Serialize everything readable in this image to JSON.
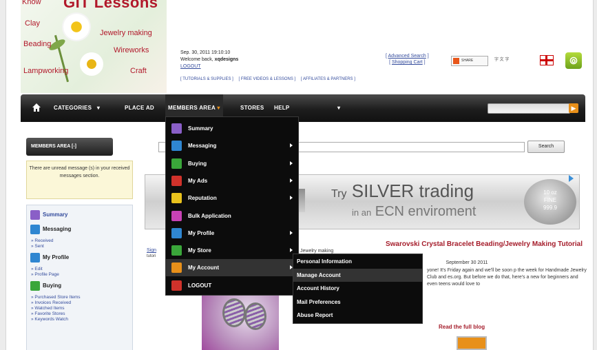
{
  "logo": {
    "title": "GIT Lessons",
    "know": "Know",
    "words": [
      "Clay",
      "Jewelry making",
      "Beading",
      "Wireworks",
      "Lampworking",
      "Craft"
    ]
  },
  "header": {
    "datetime": "Sep. 30, 2011 19:10:10",
    "welcome_prefix": "Welcome back, ",
    "username": "xqdesigns",
    "logout": "LOGOUT",
    "links": [
      "[ TUTORIALS & SUPPLIES ]",
      "[ FREE VIDEOS & LESSONS ]",
      "[ AFFILIATES & PARTNERS ]"
    ],
    "advanced_search": "Advanced Search",
    "shopping_cart": "Shopping Cart",
    "share_label": "SHARE",
    "share2_label": "字 文 字"
  },
  "nav": {
    "categories": "CATEGORIES",
    "place_ad": "PLACE AD",
    "members_area": "MEMBERS AREA",
    "stores": "STORES",
    "help": "HELP"
  },
  "members_menu": {
    "items": [
      {
        "label": "Summary",
        "color": "#8a5fc7",
        "has_sub": false
      },
      {
        "label": "Messaging",
        "color": "#2f86d1",
        "has_sub": true
      },
      {
        "label": "Buying",
        "color": "#3aa63a",
        "has_sub": true
      },
      {
        "label": "My Ads",
        "color": "#d0322b",
        "has_sub": true
      },
      {
        "label": "Reputation",
        "color": "#e9c21d",
        "has_sub": true
      },
      {
        "label": "Bulk Application",
        "color": "#c842b5",
        "has_sub": false
      },
      {
        "label": "My Profile",
        "color": "#2f86d1",
        "has_sub": true
      },
      {
        "label": "My Store",
        "color": "#3aa63a",
        "has_sub": true
      },
      {
        "label": "My Account",
        "color": "#e8901a",
        "has_sub": true
      },
      {
        "label": "LOGOUT",
        "color": "#d0322b",
        "has_sub": false
      }
    ],
    "active": "My Account"
  },
  "account_submenu": {
    "items": [
      "Personal Information",
      "Manage Account",
      "Account History",
      "Mail Preferences",
      "Abuse Report"
    ],
    "active": "Manage Account"
  },
  "sidebar": {
    "heading": "MEMBERS AREA [-]",
    "alert": "There are unread message (s) in your received messages section.",
    "summary": "Summary",
    "messaging": "Messaging",
    "messaging_links": [
      "» Received",
      "» Sent"
    ],
    "profile": "My Profile",
    "profile_links": [
      "» Edit",
      "» Profile Page"
    ],
    "buying": "Buying",
    "buying_links": [
      "» Purchased Store Items",
      "» Invoices Received",
      "» Watched Items",
      "» Favorite Stores",
      "» Keywords Watch"
    ]
  },
  "main": {
    "search_button": "Search",
    "ad": {
      "line1_small": "Try",
      "line1_big": "SILVER trading",
      "line2_small": "in an",
      "line2_big": "ECN enviroment",
      "coin_lines": [
        "10 oz",
        "FINE",
        "999.9"
      ]
    },
    "signin": "Sign",
    "tutor": "tutori",
    "jewelry_making": "Jewelry making",
    "blog": {
      "title": "Swarovski Crystal Bracelet Beading/Jewelry Making Tutorial",
      "date": "September 30 2011",
      "text": "yone! It's Friday again and we'll be soon p the week for Handmade Jewelry Club and es.org. But before we do that, here's a new for beginners and even teens would love to",
      "read_more": "Read the full blog"
    }
  }
}
